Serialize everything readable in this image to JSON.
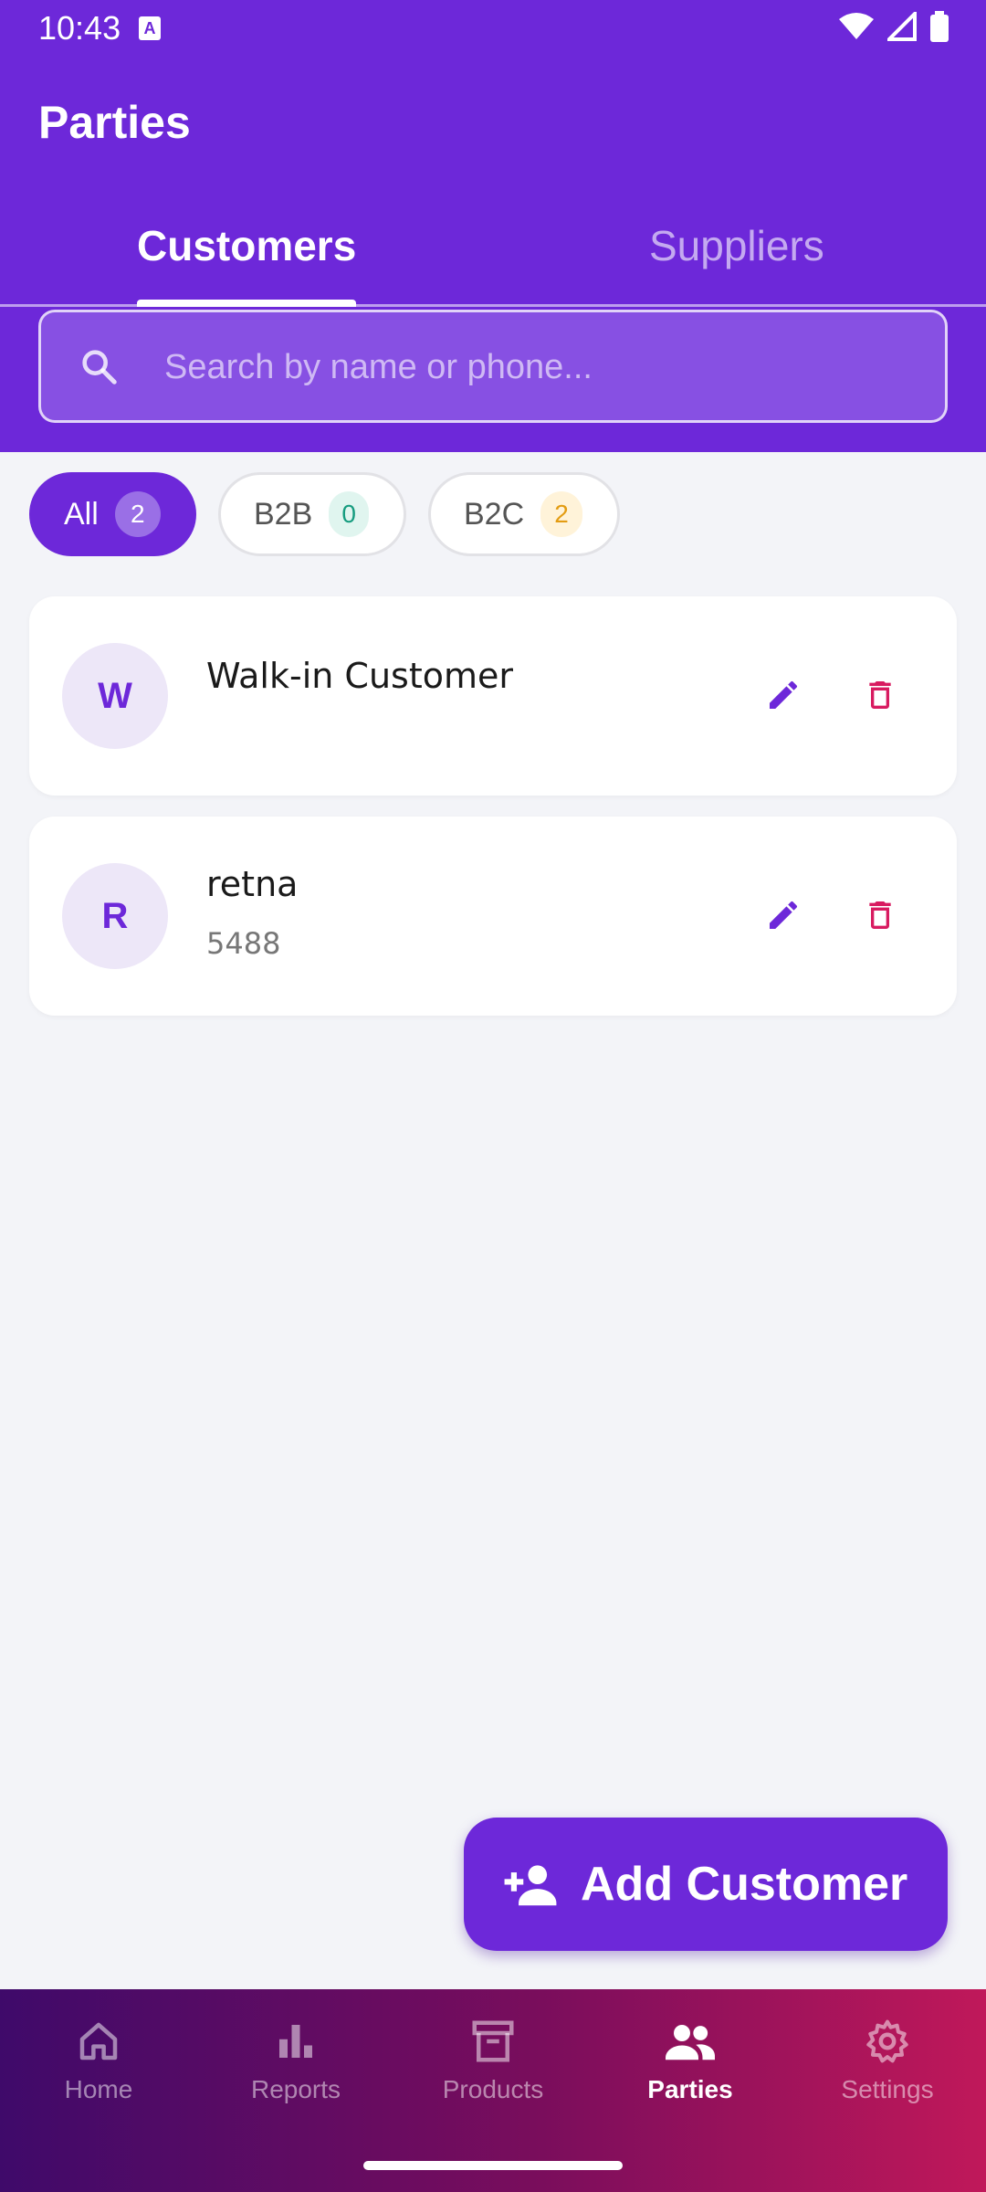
{
  "status_bar": {
    "time": "10:43",
    "indicator": "A"
  },
  "header": {
    "title": "Parties"
  },
  "tabs": [
    {
      "label": "Customers",
      "active": true
    },
    {
      "label": "Suppliers",
      "active": false
    }
  ],
  "search": {
    "placeholder": "Search by name or phone..."
  },
  "filters": [
    {
      "label": "All",
      "count": "2"
    },
    {
      "label": "B2B",
      "count": "0"
    },
    {
      "label": "B2C",
      "count": "2"
    }
  ],
  "customers": [
    {
      "initial": "W",
      "name": "Walk-in Customer",
      "phone": ""
    },
    {
      "initial": "R",
      "name": "retna",
      "phone": "5488"
    }
  ],
  "fab": {
    "label": "Add Customer",
    "icon": "person-add-icon"
  },
  "bottom_nav": [
    {
      "label": "Home",
      "icon": "home-icon"
    },
    {
      "label": "Reports",
      "icon": "bar-chart-icon"
    },
    {
      "label": "Products",
      "icon": "archive-box-icon"
    },
    {
      "label": "Parties",
      "icon": "people-icon",
      "active": true
    },
    {
      "label": "Settings",
      "icon": "gear-icon"
    }
  ],
  "colors": {
    "primary": "#6d28d9",
    "delete": "#d81b60",
    "background": "#f3f4f8"
  }
}
